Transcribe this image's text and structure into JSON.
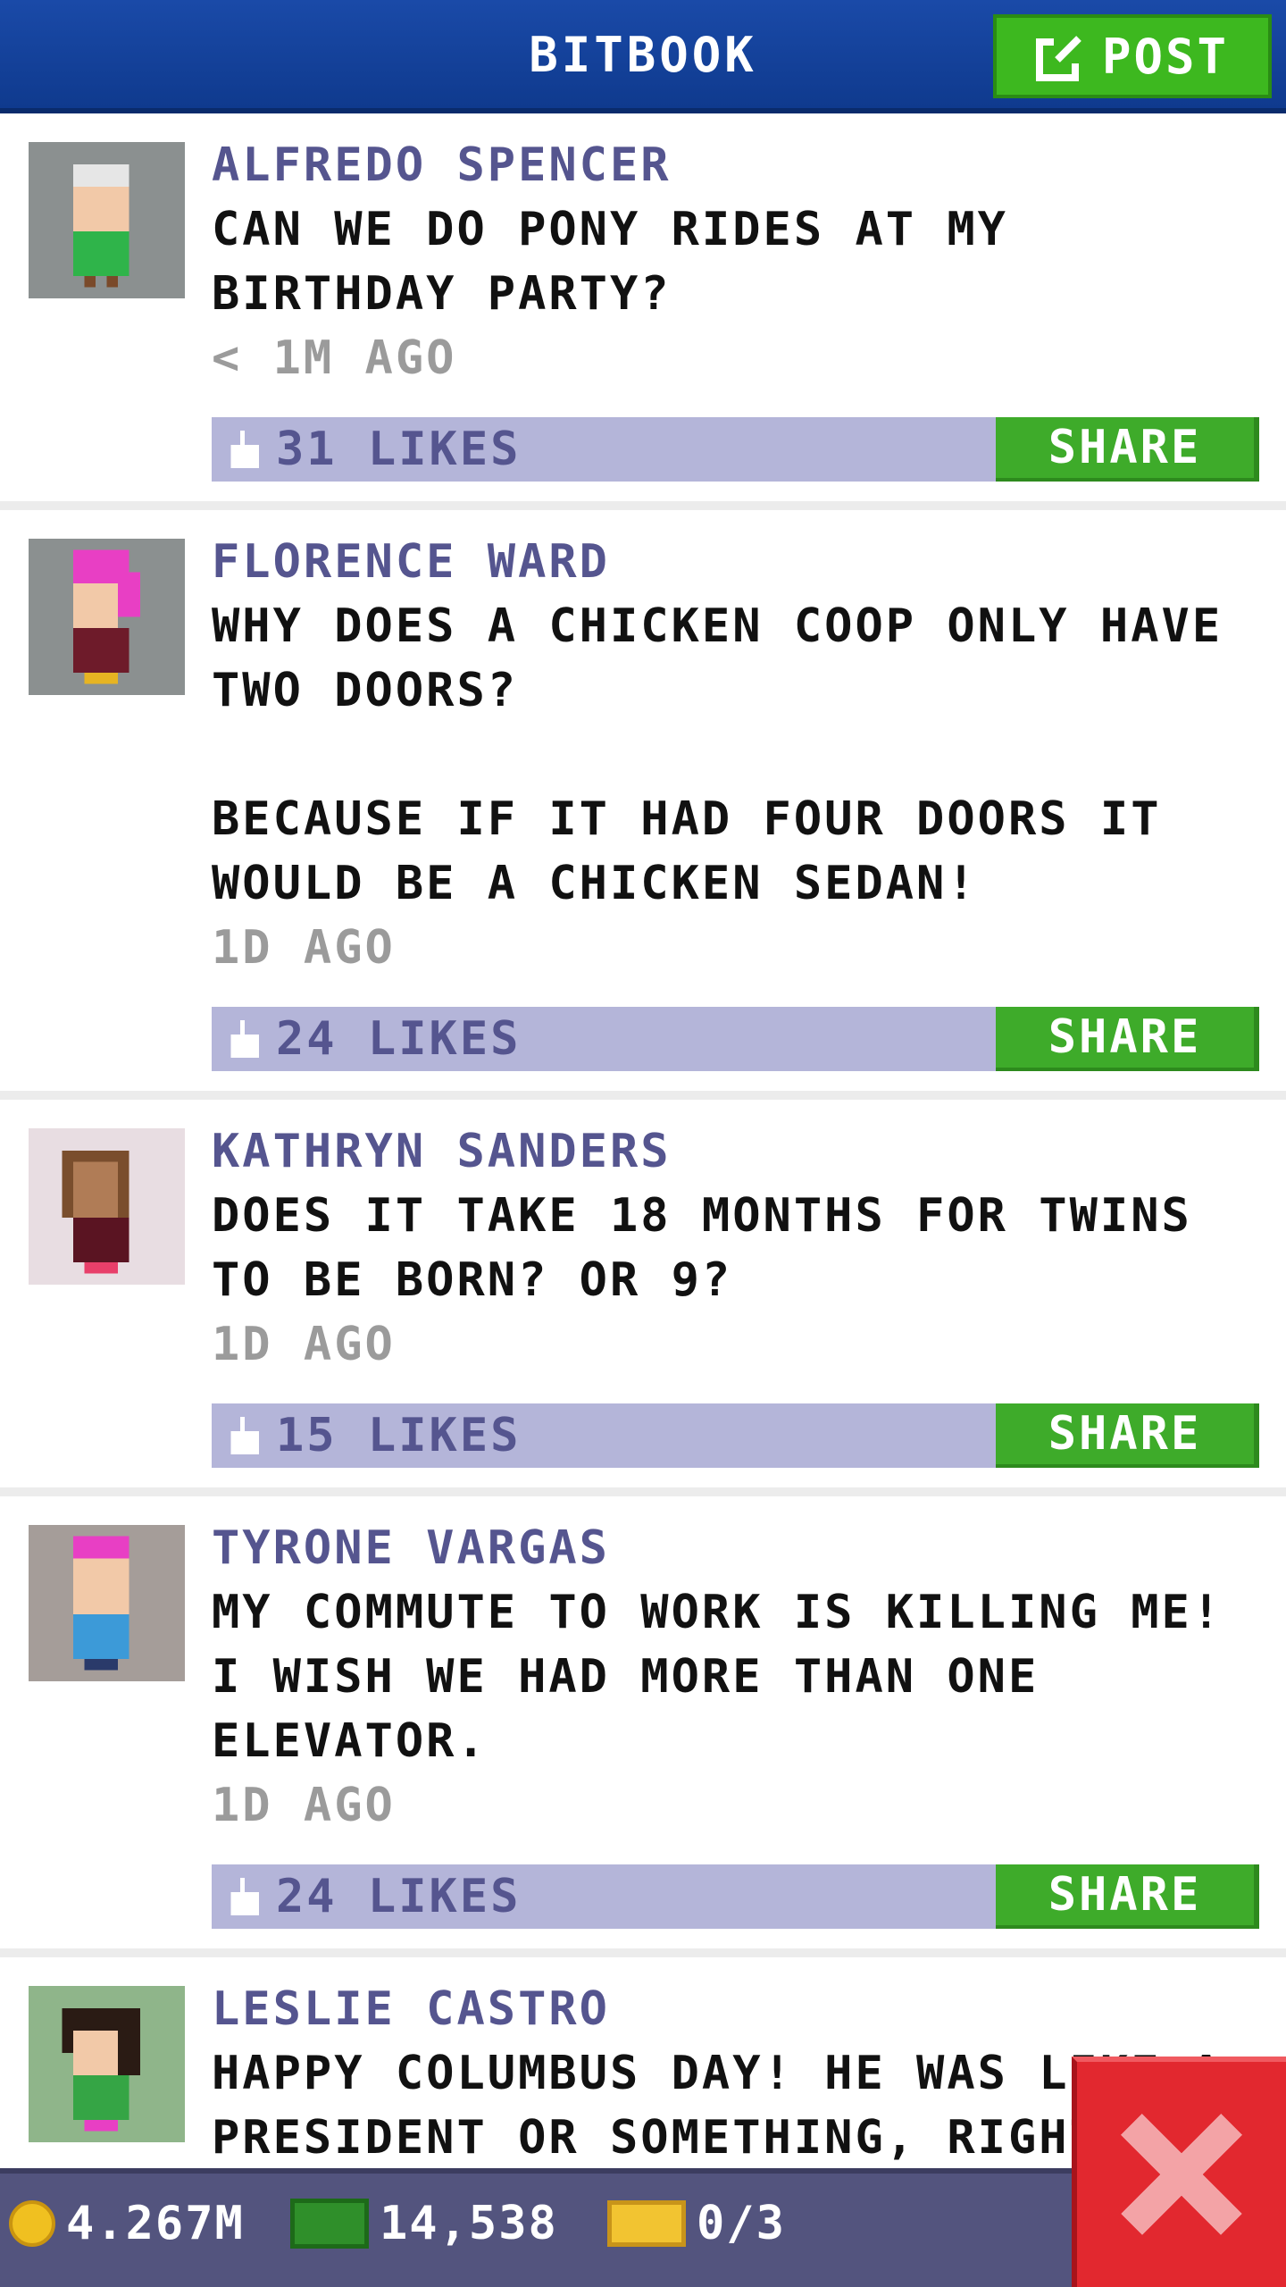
{
  "header": {
    "title": "BITBOOK",
    "post_label": "POST"
  },
  "posts": [
    {
      "author": "ALFREDO SPENCER",
      "text": "CAN WE DO PONY RIDES AT MY BIRTHDAY PARTY?",
      "time": "< 1M AGO",
      "likes": "31 LIKES",
      "share": "SHARE"
    },
    {
      "author": "FLORENCE WARD",
      "text": "WHY DOES A CHICKEN COOP ONLY HAVE TWO DOORS?\n\nBECAUSE IF IT HAD FOUR DOORS IT WOULD BE A CHICKEN SEDAN!",
      "time": "1D AGO",
      "likes": "24 LIKES",
      "share": "SHARE"
    },
    {
      "author": "KATHRYN SANDERS",
      "text": "DOES IT TAKE 18 MONTHS FOR TWINS TO BE BORN? OR 9?",
      "time": "1D AGO",
      "likes": "15 LIKES",
      "share": "SHARE"
    },
    {
      "author": "TYRONE VARGAS",
      "text": "MY COMMUTE TO WORK IS KILLING ME! I WISH WE HAD MORE THAN ONE ELEVATOR.",
      "time": "1D AGO",
      "likes": "24 LIKES",
      "share": "SHARE"
    },
    {
      "author": "LESLIE CASTRO",
      "text": "HAPPY COLUMBUS DAY! HE WAS LIKE A PRESIDENT OR SOMETHING, RIGHT?",
      "time": "",
      "likes": "",
      "share": ""
    }
  ],
  "status": {
    "coins": "4.267M",
    "bux": "14,538",
    "tickets": "0/3"
  },
  "colors": {
    "header": "#1a4aa8",
    "accent_green": "#3eab2a",
    "likes_bar": "#b4b5d9",
    "author": "#55558f",
    "close": "#e2282f"
  }
}
